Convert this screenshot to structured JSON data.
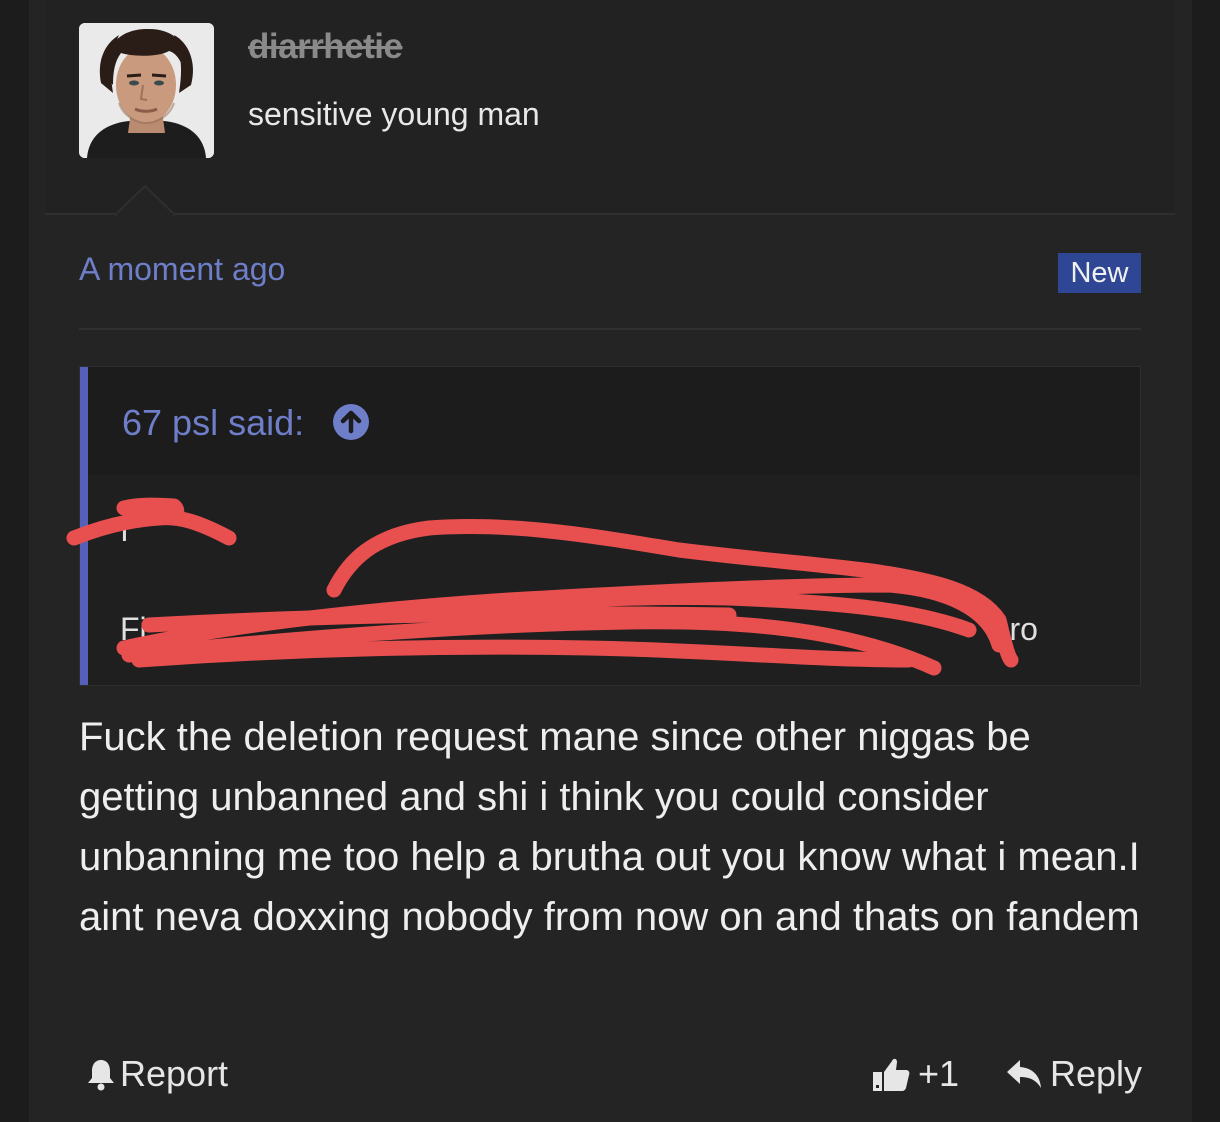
{
  "user": {
    "username": "diarrhetie",
    "title": "sensitive young man"
  },
  "post": {
    "time": "A moment ago",
    "badge": "New"
  },
  "quote": {
    "author": "67 psl said:",
    "line1": "I",
    "line2_visible_start": "Fi",
    "line2_visible_end": "pro"
  },
  "message": "Fuck the deletion request mane since other niggas be getting unbanned and shi i think you could consider unbanning me too help a brutha out you know what i mean.I aint neva doxxing nobody from now on and thats on fandem",
  "actions": {
    "report_label": "Report",
    "like_label": "+1",
    "reply_label": "Reply"
  },
  "colors": {
    "background": "#1c1c1c",
    "post": "#242424",
    "link": "#6f7ec9",
    "badge": "#2e4693",
    "quote_bar": "#5660b8",
    "scribble": "#e8504f"
  },
  "icons": {
    "avatar": "avatar-photo",
    "quote_up": "arrow-up-circle-icon",
    "report": "bell-icon",
    "like": "thumbs-up-icon",
    "reply": "reply-arrow-icon"
  }
}
